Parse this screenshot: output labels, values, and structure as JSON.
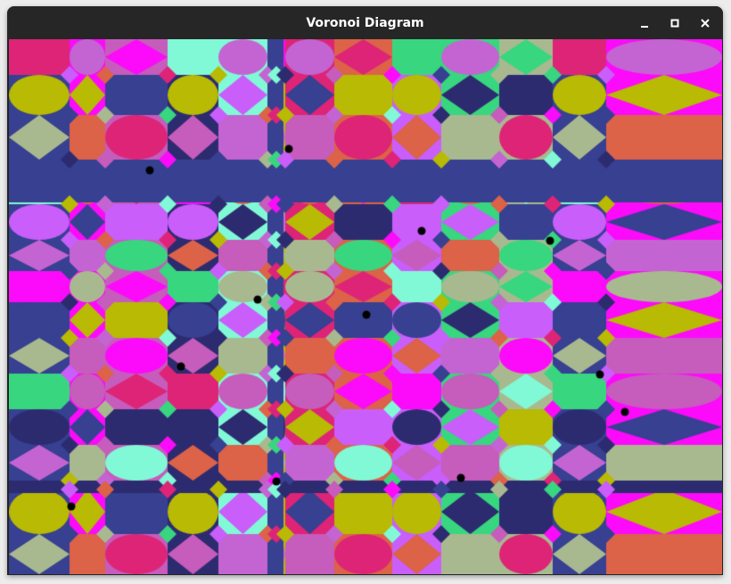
{
  "window": {
    "title": "Voronoi Diagram",
    "controls": {
      "minimize": "minimize-icon",
      "maximize": "maximize-icon",
      "close": "close-icon"
    }
  },
  "diagram": {
    "palette": [
      "#dd2477",
      "#374091",
      "#c464d2",
      "#38d67f",
      "#2d2b70",
      "#dc6248",
      "#fc0afa",
      "#b8ba03",
      "#a9b98f",
      "#81f9d6",
      "#c95efb",
      "#c65cbc"
    ],
    "site_color": "#000000"
  }
}
